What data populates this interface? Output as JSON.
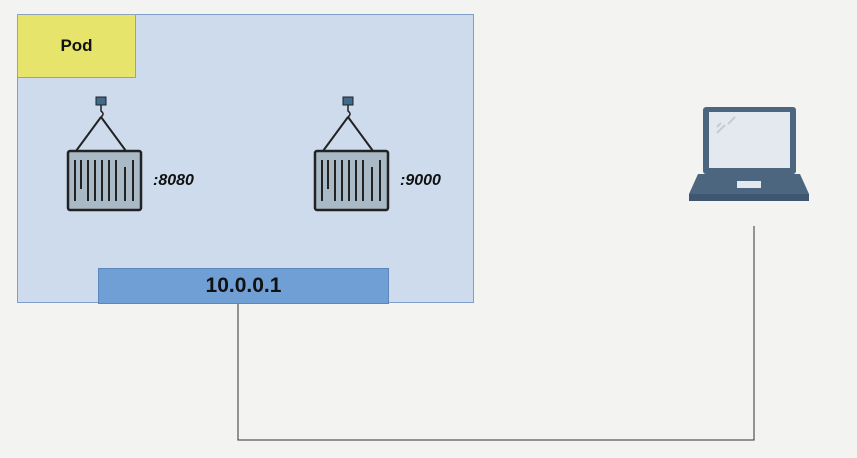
{
  "pod": {
    "label": "Pod",
    "ip": "10.0.0.1",
    "fill": "#cddbec",
    "label_fill": "#e6e46a",
    "ip_fill": "#6f9fd4"
  },
  "containers": [
    {
      "icon": "shipping-container-icon",
      "port": ":8080"
    },
    {
      "icon": "shipping-container-icon",
      "port": ":9000"
    }
  ],
  "client": {
    "icon": "laptop-icon",
    "color": "#4d6680"
  }
}
